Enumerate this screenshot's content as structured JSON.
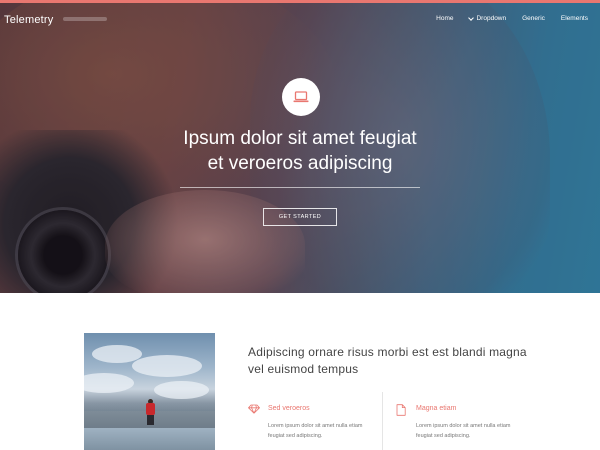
{
  "header": {
    "logo": "Telemetry",
    "nav": [
      {
        "label": "Home",
        "dropdown": false
      },
      {
        "label": "Dropdown",
        "dropdown": true
      },
      {
        "label": "Generic",
        "dropdown": false
      },
      {
        "label": "Elements",
        "dropdown": false
      }
    ]
  },
  "hero": {
    "icon": "laptop-icon",
    "heading_line1": "Ipsum dolor sit amet feugiat",
    "heading_line2": "et veroeros adipiscing",
    "button_label": "GET STARTED"
  },
  "main": {
    "heading_line1": "Adipiscing ornare risus morbi est est blandi magna",
    "heading_line2": "vel euismod tempus",
    "features": [
      {
        "icon": "diamond-icon",
        "title": "Sed veroeros",
        "desc": "Lorem ipsum dolor sit amet nulla etiam feugiat sed adipiscing."
      },
      {
        "icon": "document-icon",
        "title": "Magna etiam",
        "desc": "Lorem ipsum dolor sit amet nulla etiam feugiat sed adipiscing."
      }
    ]
  },
  "colors": {
    "accent": "#e97770",
    "hero_blue": "#2d86ab"
  }
}
